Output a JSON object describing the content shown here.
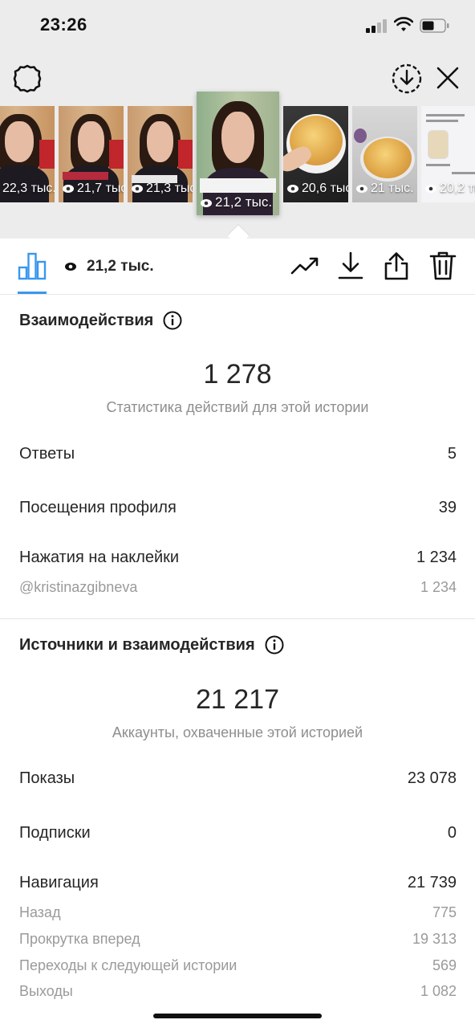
{
  "status_bar": {
    "time": "23:26"
  },
  "thumbnails": [
    {
      "views": "22,3 тыс.",
      "kind": "person"
    },
    {
      "views": "21,7 тыс.",
      "kind": "person"
    },
    {
      "views": "21,3 тыс.",
      "kind": "person"
    },
    {
      "views": "21,2 тыс.",
      "kind": "person",
      "selected": true
    },
    {
      "views": "20,6 тыс.",
      "kind": "pie"
    },
    {
      "views": "21 тыс.",
      "kind": "pie"
    },
    {
      "views": "20,2 тыс.",
      "kind": "chat"
    }
  ],
  "action_bar": {
    "views": "21,2 тыс."
  },
  "interactions": {
    "title": "Взаимодействия",
    "total": "1 278",
    "caption": "Статистика действий для этой истории",
    "rows": [
      {
        "label": "Ответы",
        "value": "5"
      },
      {
        "label": "Посещения профиля",
        "value": "39"
      },
      {
        "label": "Нажатия на наклейки",
        "value": "1 234"
      }
    ],
    "sticker": {
      "label": "@kristinazgibneva",
      "value": "1 234"
    }
  },
  "discovery": {
    "title": "Источники и взаимодействия",
    "total": "21 217",
    "caption": "Аккаунты, охваченные этой историей",
    "rows": [
      {
        "label": "Показы",
        "value": "23 078"
      },
      {
        "label": "Подписки",
        "value": "0"
      },
      {
        "label": "Навигация",
        "value": "21 739"
      }
    ],
    "navigation": [
      {
        "label": "Назад",
        "value": "775"
      },
      {
        "label": "Прокрутка вперед",
        "value": "19 313"
      },
      {
        "label": "Переходы к следующей истории",
        "value": "569"
      },
      {
        "label": "Выходы",
        "value": "1 082"
      }
    ]
  },
  "colors": {
    "accent": "#3897f0",
    "text": "#262626",
    "muted": "#8e8e8e",
    "header_bg": "#ececec"
  },
  "icons": [
    "settings-icon",
    "save-icon",
    "close-icon",
    "chart-icon",
    "eye-icon",
    "trend-icon",
    "download-icon",
    "share-icon",
    "trash-icon",
    "info-icon"
  ]
}
